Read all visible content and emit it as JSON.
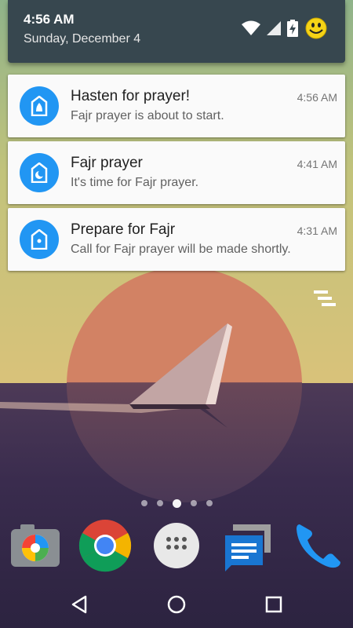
{
  "status": {
    "time": "4:56 AM",
    "date": "Sunday, December 4",
    "icons": [
      "wifi-icon",
      "cellular-signal-icon",
      "battery-charging-icon",
      "smiley-avatar-icon"
    ]
  },
  "notifications": [
    {
      "title": "Hasten for prayer!",
      "time": "4:56 AM",
      "body": "Fajr prayer is about to start.",
      "icon": "mosque-lock-icon"
    },
    {
      "title": "Fajr prayer",
      "time": "4:41 AM",
      "body": "It's time for Fajr prayer.",
      "icon": "mosque-crescent-icon"
    },
    {
      "title": "Prepare for Fajr",
      "time": "4:31 AM",
      "body": "Call for Fajr prayer will be made shortly.",
      "icon": "mosque-dot-icon"
    }
  ],
  "clear_all": {
    "icon": "clear-all-icon"
  },
  "home": {
    "page_count": 5,
    "active_page_index": 2,
    "dock": [
      "camera-app-icon",
      "chrome-app-icon",
      "app-drawer-icon",
      "messenger-app-icon",
      "phone-app-icon"
    ]
  },
  "navbar": {
    "buttons": [
      "back-icon",
      "home-icon",
      "recents-icon"
    ]
  },
  "colors": {
    "header_bg": "#37474f",
    "notification_icon_bg": "#2196f3",
    "card_bg": "#fafafa"
  }
}
